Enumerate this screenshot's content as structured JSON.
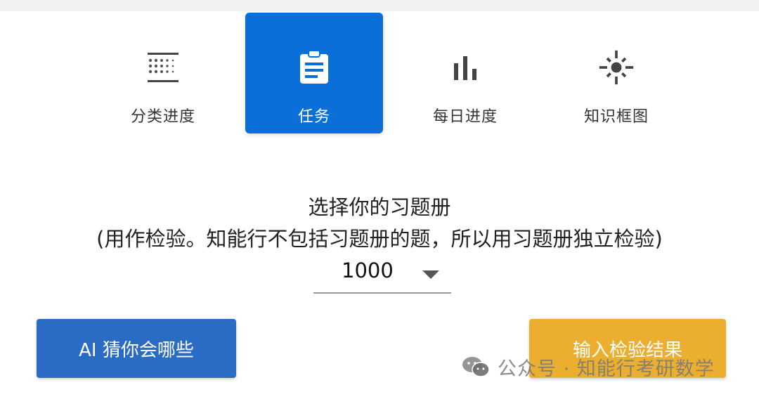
{
  "tabs": [
    {
      "label": "分类进度",
      "icon": "category-grid-icon",
      "active": false
    },
    {
      "label": "任务",
      "icon": "clipboard-icon",
      "active": true
    },
    {
      "label": "每日进度",
      "icon": "bar-chart-icon",
      "active": false
    },
    {
      "label": "知识框图",
      "icon": "sun-node-icon",
      "active": false
    }
  ],
  "prompt": {
    "title": "选择你的习题册",
    "note": "(用作检验。知能行不包括习题册的题，所以用习题册独立检验)"
  },
  "workbook_select": {
    "selected": "1000"
  },
  "buttons": {
    "ai_guess": "AI 猜你会哪些",
    "enter_results": "输入检验结果"
  },
  "watermark": {
    "text": "公众号 · 知能行考研数学",
    "icon": "wechat-icon"
  },
  "colors": {
    "active_tab": "#0a6fd8",
    "ai_button": "#2a6bc4",
    "result_button": "#ebae2e"
  }
}
